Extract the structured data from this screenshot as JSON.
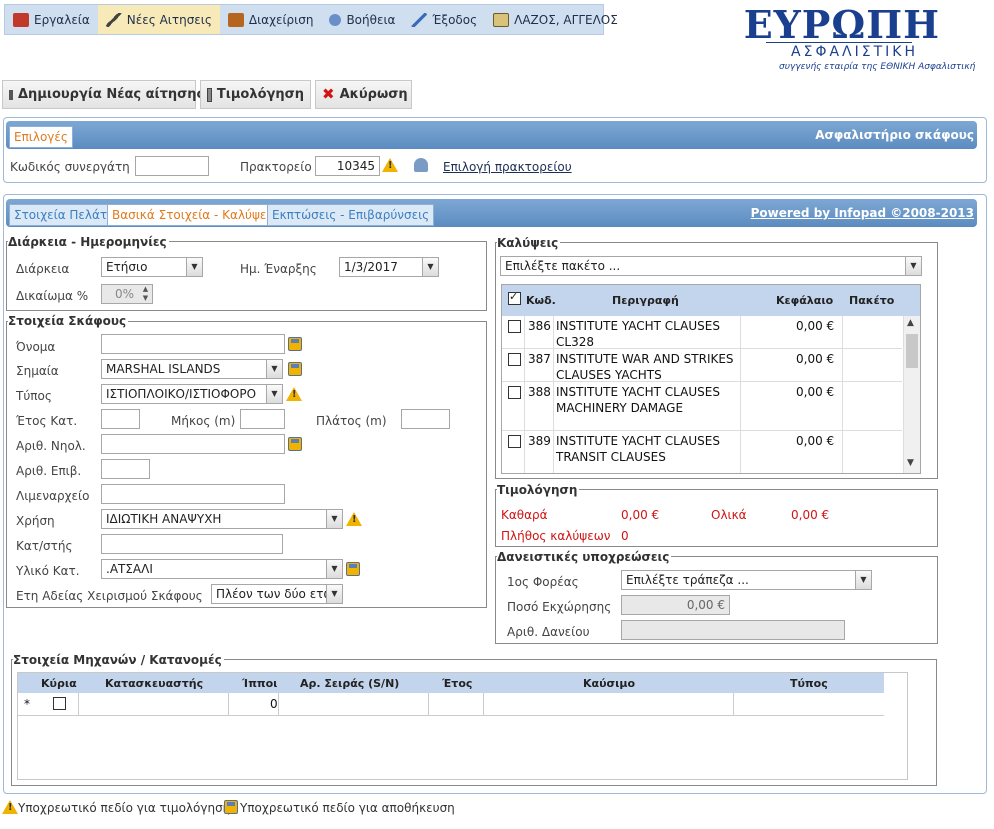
{
  "menu": {
    "items": [
      {
        "label": "Εργαλεία",
        "icon": "toolbox-icon"
      },
      {
        "label": "Νέες Αιτησεις",
        "icon": "magic-wand-icon"
      },
      {
        "label": "Διαχείριση",
        "icon": "briefcase-icon"
      },
      {
        "label": "Βοήθεια",
        "icon": "help-icon"
      },
      {
        "label": "Έξοδος",
        "icon": "exit-icon"
      },
      {
        "label": "ΛΑΖΟΣ, ΑΓΓΕΛΟΣ",
        "icon": "user-card-icon"
      }
    ]
  },
  "logo": {
    "name": "ΕΥΡΩΠΗ",
    "subtitle": "ΑΣΦΑΛΙΣΤΙΚΗ",
    "tagline": "συγγενής εταιρία της ΕΘΝΙΚΗ Ασφαλιστική"
  },
  "toolbar": {
    "create": "Δημιουργία Νέας αίτησης",
    "invoice": "Τιμολόγηση",
    "cancel": "Ακύρωση"
  },
  "options": {
    "tab": "Επιλογές",
    "title": "Ασφαλιστήριο σκάφους",
    "partner_label": "Κωδικός συνεργάτη",
    "partner_value": "",
    "office_label": "Πρακτορείο",
    "office_value": "10345",
    "office_link": "Επιλογή πρακτορείου"
  },
  "tabs": {
    "customer": "Στοιχεία Πελάτη",
    "basic": "Βασικά Στοιχεία - Καλύψεις",
    "discounts": "Εκπτώσεις - Επιβαρύνσεις",
    "powered": "Powered by Infopad ©2008-2013"
  },
  "duration": {
    "legend": "Διάρκεια - Ημερομηνίες",
    "duration_label": "Διάρκεια",
    "duration_value": "Ετήσιο",
    "start_label": "Ημ. Έναρξης",
    "start_value": "1/3/2017",
    "right_label": "Δικαίωμα %",
    "right_value": "0%"
  },
  "vessel": {
    "legend": "Στοιχεία Σκάφους",
    "name_label": "Όνομα",
    "name_value": "",
    "flag_label": "Σημαία",
    "flag_value": "MARSHAL ISLANDS",
    "type_label": "Τύπος",
    "type_value": "ΙΣΤΙΟΠΛΟΙΚΟ/ΙΣΤΙΟΦΟΡΟ",
    "year_label": "Έτος Κατ.",
    "length_label": "Μήκος (m)",
    "width_label": "Πλάτος (m)",
    "reg_label": "Αριθ. Νηολ.",
    "pass_label": "Αριθ. Επιβ.",
    "port_label": "Λιμεναρχείο",
    "use_label": "Χρήση",
    "use_value": "ΙΔΙΩΤΙΚΗ ΑΝΑΨΥΧΗ",
    "builder_label": "Κατ/στής",
    "material_label": "Υλικό Κατ.",
    "material_value": ".ΑΤΣΑΛΙ",
    "license_label": "Ετη Αδείας Χειρισμού Σκάφους",
    "license_value": "Πλέον των δύο ετών"
  },
  "coverages": {
    "legend": "Καλύψεις",
    "package_select": "Επιλέξτε πακέτο ...",
    "columns": [
      "Κωδ.",
      "Περιγραφή",
      "Κεφάλαιο",
      "Πακέτο"
    ],
    "rows": [
      {
        "code": "386",
        "desc": "INSTITUTE YACHT CLAUSES CL328",
        "capital": "0,00 €"
      },
      {
        "code": "387",
        "desc": "INSTITUTE WAR AND STRIKES CLAUSES YACHTS",
        "capital": "0,00 €"
      },
      {
        "code": "388",
        "desc": "INSTITUTE YACHT CLAUSES MACHINERY DAMAGE",
        "capital": "0,00 €"
      },
      {
        "code": "389",
        "desc": "INSTITUTE YACHT CLAUSES TRANSIT CLAUSES",
        "capital": "0,00 €"
      }
    ]
  },
  "pricing": {
    "legend": "Τιμολόγηση",
    "net_label": "Καθαρά",
    "net_value": "0,00 €",
    "total_label": "Ολικά",
    "total_value": "0,00 €",
    "count_label": "Πλήθος καλύψεων",
    "count_value": "0"
  },
  "loan": {
    "legend": "Δανειστικές υποχρεώσεις",
    "bank_label": "1ος Φορέας",
    "bank_value": "Επιλέξτε τράπεζα ...",
    "amount_label": "Ποσό Εκχώρησης",
    "amount_value": "0,00 €",
    "loan_label": "Αριθ. Δανείου"
  },
  "engines": {
    "legend": "Στοιχεία Μηχανών / Κατανομές",
    "columns": [
      "Κύρια",
      "Κατασκευαστής",
      "Ίπποι",
      "Αρ. Σειράς (S/N)",
      "Έτος",
      "Καύσιμο",
      "Τύπος"
    ],
    "new_row_marker": "*",
    "hp_value": "0"
  },
  "footer": {
    "warn_text": "Υποχρεωτικό πεδίο για τιμολόγηση",
    "save_text": "Υποχρεωτικό πεδίο για αποθήκευση"
  }
}
